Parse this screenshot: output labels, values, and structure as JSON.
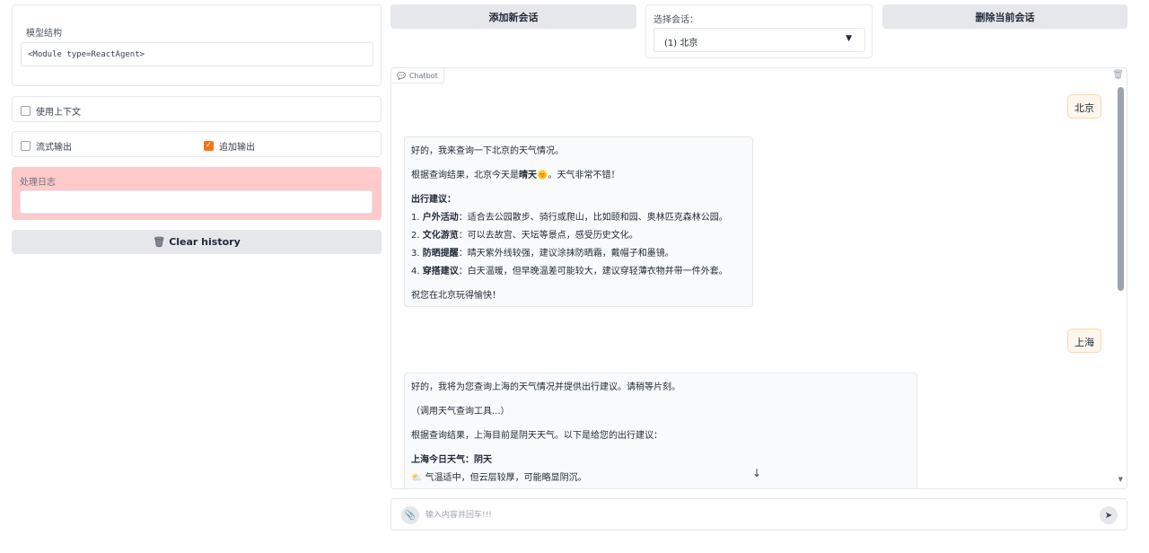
{
  "left": {
    "model_label": "模型结构",
    "model_value": "<Module type=ReactAgent>",
    "context_label": "使用上下文",
    "stream_label": "流式输出",
    "append_label": "追加输出",
    "log_label": "处理日志",
    "clear_label": "Clear history"
  },
  "top": {
    "add_label": "添加新会话",
    "select_label": "选择会话：",
    "select_value": "(1) 北京",
    "delete_label": "删除当前会话"
  },
  "chat": {
    "tag": "Chatbot",
    "user1": "北京",
    "bot1": {
      "p1": "好的，我来查询一下北京的天气情况。",
      "p2_a": "根据查询结果，北京今天是",
      "p2_bold": "晴天",
      "p2_b": "🌞。天气非常不错！",
      "heading": "出行建议：",
      "items": [
        {
          "n": "1.",
          "k": "户外活动",
          "v": "：适合去公园散步、骑行或爬山，比如颐和园、奥林匹克森林公园。"
        },
        {
          "n": "2.",
          "k": "文化游览",
          "v": "：可以去故宫、天坛等景点，感受历史文化。"
        },
        {
          "n": "3.",
          "k": "防晒提醒",
          "v": "：晴天紫外线较强，建议涂抹防晒霜，戴帽子和墨镜。"
        },
        {
          "n": "4.",
          "k": "穿搭建议",
          "v": "：白天温暖，但早晚温差可能较大，建议穿轻薄衣物并带一件外套。"
        }
      ],
      "closing": "祝您在北京玩得愉快！"
    },
    "user2": "上海",
    "bot2": {
      "p1": "好的，我将为您查询上海的天气情况并提供出行建议。请稍等片刻。",
      "p2": "（调用天气查询工具...）",
      "p3": "根据查询结果，上海目前是阴天天气。以下是给您的出行建议：",
      "heading": "上海今日天气：阴天",
      "line": "⛅ 气温适中，但云层较厚，可能略显阴沉。"
    }
  },
  "input": {
    "placeholder": "输入内容并回车!!!"
  }
}
